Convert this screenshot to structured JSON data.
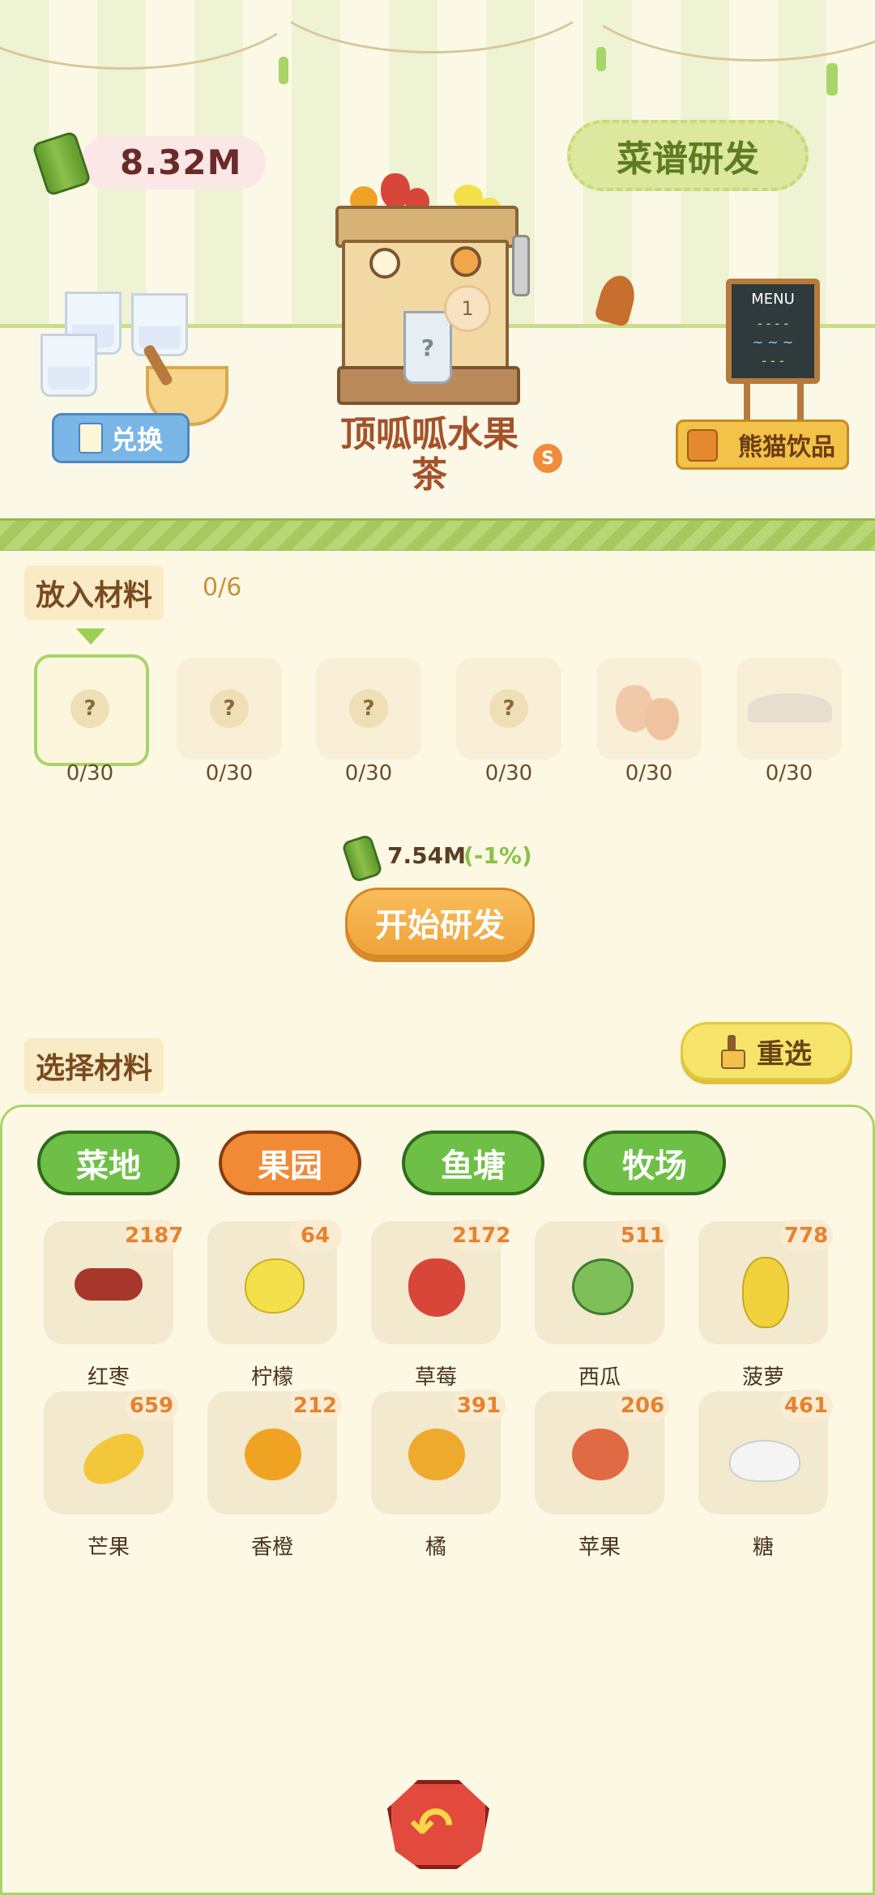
{
  "currency": {
    "value": "8.32M",
    "icon": "bamboo-icon"
  },
  "recipe_button": {
    "label": "菜谱研发"
  },
  "exchange_button": {
    "label": "兑换"
  },
  "drink": {
    "name": "顶呱呱水果茶",
    "rank": "S",
    "machine_badge": "1",
    "cup_mark": "?"
  },
  "menu_board": {
    "title": "MENU"
  },
  "panda_sign": {
    "label": "熊猫饮品"
  },
  "put_section": {
    "title": "放入材料",
    "count": "0/6",
    "slots": [
      {
        "mark": "?",
        "count": "0/30"
      },
      {
        "mark": "?",
        "count": "0/30"
      },
      {
        "mark": "?",
        "count": "0/30"
      },
      {
        "mark": "?",
        "count": "0/30"
      },
      {
        "mark": "",
        "count": "0/30"
      },
      {
        "mark": "",
        "count": "0/30"
      }
    ]
  },
  "cost": {
    "value": "7.54M",
    "discount": "(-1%)"
  },
  "start_button": {
    "label": "开始研发"
  },
  "select_section": {
    "title": "选择材料",
    "reselect_label": "重选"
  },
  "tabs": [
    {
      "label": "菜地"
    },
    {
      "label": "果园"
    },
    {
      "label": "鱼塘"
    },
    {
      "label": "牧场"
    }
  ],
  "items": [
    {
      "name": "红枣",
      "qty": "2187",
      "icon": "jujube-icon",
      "color": "#a7372a"
    },
    {
      "name": "柠檬",
      "qty": "64",
      "icon": "lemon-icon",
      "color": "#f4e04a"
    },
    {
      "name": "草莓",
      "qty": "2172",
      "icon": "strawberry-icon",
      "color": "#d8463a"
    },
    {
      "name": "西瓜",
      "qty": "511",
      "icon": "watermelon-icon",
      "color": "#7fbf5a"
    },
    {
      "name": "菠萝",
      "qty": "778",
      "icon": "pineapple-icon",
      "color": "#f2d23c"
    },
    {
      "name": "芒果",
      "qty": "659",
      "icon": "mango-icon",
      "color": "#f2c83a"
    },
    {
      "name": "香橙",
      "qty": "212",
      "icon": "orange-icon",
      "color": "#f0a322"
    },
    {
      "name": "橘",
      "qty": "391",
      "icon": "tangerine-icon",
      "color": "#eeaa2c"
    },
    {
      "name": "苹果",
      "qty": "206",
      "icon": "apple-icon",
      "color": "#df6a43"
    },
    {
      "name": "糖",
      "qty": "461",
      "icon": "sugar-icon",
      "color": "#f4f4f4"
    }
  ],
  "back_button": {
    "icon": "back-arrow-icon"
  }
}
